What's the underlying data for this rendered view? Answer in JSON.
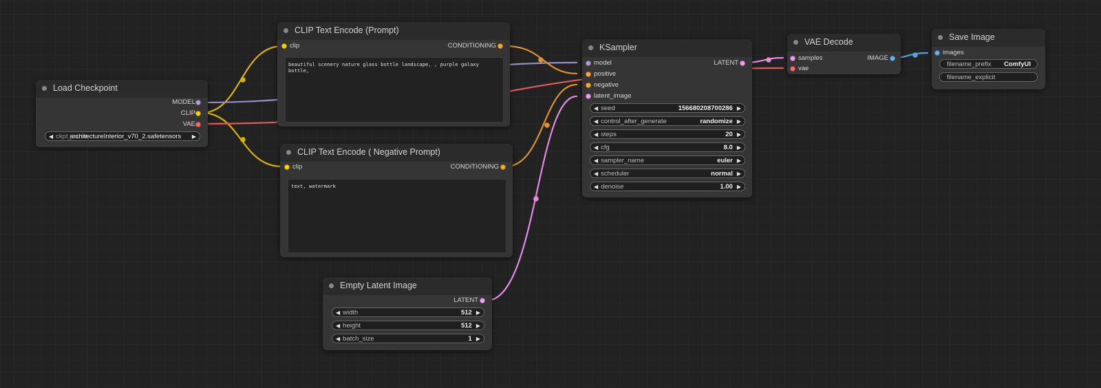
{
  "colors": {
    "canvas": "#222222",
    "node_body": "#353535",
    "node_header": "#2b2b2b",
    "model": "#b39ddb",
    "clip": "#ffd500",
    "vae": "#ff6e6e",
    "conditioning": "#ffa931",
    "latent": "#ff9cf9",
    "image": "#64b5f6"
  },
  "nodes": {
    "load_checkpoint": {
      "title": "Load Checkpoint",
      "outputs": [
        "MODEL",
        "CLIP",
        "VAE"
      ],
      "ckpt_name": {
        "label": "ckpt_name",
        "value": "architectureInterior_v70_2.safetensors"
      }
    },
    "clip_pos": {
      "title": "CLIP Text Encode (Prompt)",
      "input": "clip",
      "output": "CONDITIONING",
      "text": "beautiful scenery nature glass bottle landscape, , purple galaxy bottle,"
    },
    "clip_neg": {
      "title": "CLIP Text Encode ( Negative Prompt)",
      "input": "clip",
      "output": "CONDITIONING",
      "text": "text, watermark"
    },
    "empty_latent": {
      "title": "Empty Latent Image",
      "output": "LATENT",
      "widgets": [
        {
          "label": "width",
          "value": "512"
        },
        {
          "label": "height",
          "value": "512"
        },
        {
          "label": "batch_size",
          "value": "1"
        }
      ]
    },
    "ksampler": {
      "title": "KSampler",
      "inputs": [
        "model",
        "positive",
        "negative",
        "latent_image"
      ],
      "output": "LATENT",
      "widgets": [
        {
          "label": "seed",
          "value": "156680208700286"
        },
        {
          "label": "control_after_generate",
          "value": "randomize"
        },
        {
          "label": "steps",
          "value": "20"
        },
        {
          "label": "cfg",
          "value": "8.0"
        },
        {
          "label": "sampler_name",
          "value": "euler"
        },
        {
          "label": "scheduler",
          "value": "normal"
        },
        {
          "label": "denoise",
          "value": "1.00"
        }
      ]
    },
    "vae_decode": {
      "title": "VAE Decode",
      "inputs": [
        "samples",
        "vae"
      ],
      "output": "IMAGE"
    },
    "save_image": {
      "title": "Save Image",
      "input": "images",
      "widgets": [
        {
          "label": "filename_prefix",
          "value": "ComfyUI"
        },
        {
          "label": "filename_explicit",
          "value": ""
        }
      ]
    }
  },
  "icons": {
    "decrement": "◀",
    "increment": "▶"
  }
}
